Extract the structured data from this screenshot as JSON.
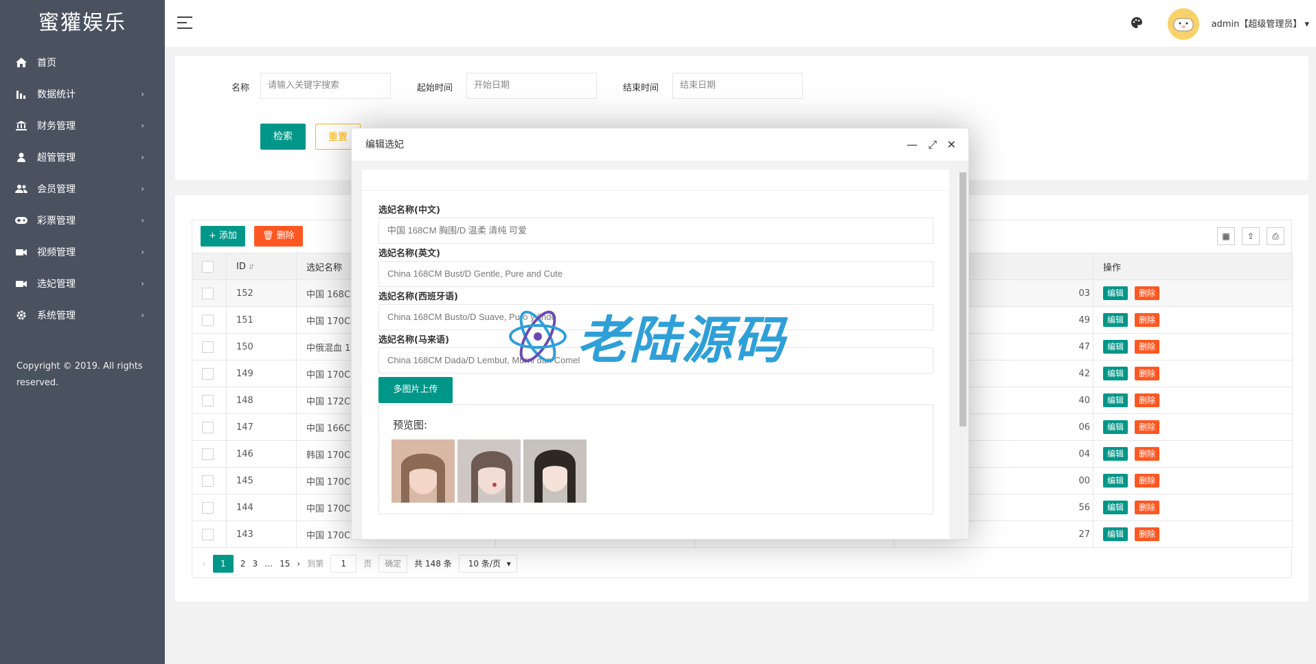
{
  "app": {
    "title": "蜜獾娱乐",
    "copyright": "Copyright © 2019. All rights reserved."
  },
  "sidebar": {
    "items": [
      {
        "label": "首页",
        "icon": "home-icon"
      },
      {
        "label": "数据统计",
        "icon": "bar-chart-icon"
      },
      {
        "label": "财务管理",
        "icon": "bank-icon"
      },
      {
        "label": "超管管理",
        "icon": "user-icon"
      },
      {
        "label": "会员管理",
        "icon": "users-icon"
      },
      {
        "label": "彩票管理",
        "icon": "gamepad-icon"
      },
      {
        "label": "视频管理",
        "icon": "video-icon"
      },
      {
        "label": "选妃管理",
        "icon": "video-icon"
      },
      {
        "label": "系统管理",
        "icon": "gear-icon"
      }
    ],
    "arrow": "›"
  },
  "header": {
    "user": "admin【超级管理员】"
  },
  "search": {
    "name_label": "名称",
    "name_placeholder": "请输入关键字搜索",
    "start_label": "起始时间",
    "start_placeholder": "开始日期",
    "end_label": "结束时间",
    "end_placeholder": "结束日期",
    "search_btn": "检索",
    "reset_btn": "重置"
  },
  "toolbar": {
    "add": "添加",
    "delete": "删除"
  },
  "table": {
    "headers": {
      "id": "ID",
      "name": "选妃名称",
      "op": "操作"
    },
    "rows": [
      {
        "id": "152",
        "name": "中国 168C",
        "time": "03"
      },
      {
        "id": "151",
        "name": "中国 170C",
        "time": "49"
      },
      {
        "id": "150",
        "name": "中俄混血 1",
        "time": "47"
      },
      {
        "id": "149",
        "name": "中国 170C",
        "time": "42"
      },
      {
        "id": "148",
        "name": "中国 172C",
        "time": "40"
      },
      {
        "id": "147",
        "name": "中国 166C",
        "time": "06"
      },
      {
        "id": "146",
        "name": "韩国 170C",
        "time": "04"
      },
      {
        "id": "145",
        "name": "中国 170C",
        "time": "00"
      },
      {
        "id": "144",
        "name": "中国 170C",
        "time": "56"
      },
      {
        "id": "143",
        "name": "中国 170C",
        "time": "27"
      }
    ],
    "edit": "编辑",
    "del": "删除"
  },
  "pager": {
    "p1": "1",
    "p2": "2",
    "p3": "3",
    "dots": "…",
    "last": "15",
    "goto": "到第",
    "page_val": "1",
    "page_unit": "页",
    "confirm": "确定",
    "total": "共 148 条",
    "size": "10 条/页"
  },
  "modal": {
    "title": "编辑选妃",
    "f1_label": "选妃名称(中文)",
    "f1_value": "中国   168CM  胸围/D   温柔  清纯  可爱",
    "f2_label": "选妃名称(英文)",
    "f2_value": "China 168CM Bust/D Gentle, Pure and Cute",
    "f3_label": "选妃名称(西班牙语)",
    "f3_value": "China 168CM Busto/D Suave, Puro y lindo",
    "f4_label": "选妃名称(马来语)",
    "f4_value": "China 168CM Dada/D Lembut, Murni dan Comel",
    "upload": "多图片上传",
    "preview": "预览图:"
  },
  "watermark": "老陆源码"
}
